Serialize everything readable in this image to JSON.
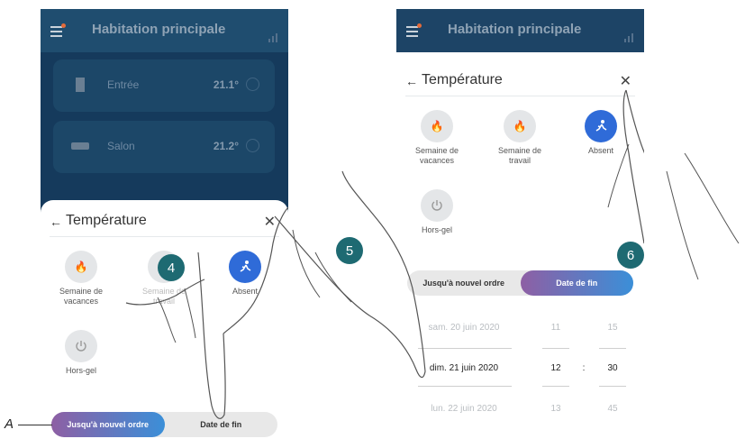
{
  "left_screen": {
    "app_title": "Habitation principale",
    "rooms": [
      {
        "name": "Entrée",
        "temp": "21.1°"
      },
      {
        "name": "Salon",
        "temp": "21.2°"
      }
    ],
    "sheet": {
      "title": "Température",
      "modes": [
        {
          "label": "Semaine de vacances",
          "icon": "flame-icon"
        },
        {
          "label": "Semaine de travail",
          "icon": "flame-icon"
        },
        {
          "label": "Absent",
          "icon": "walking-person-icon"
        },
        {
          "label": "Hors-gel",
          "icon": "power-icon"
        }
      ],
      "segment": {
        "option_1": "Jusqu'à nouvel ordre",
        "option_2": "Date de fin",
        "selected": "option_1"
      }
    }
  },
  "right_screen": {
    "app_title": "Habitation principale",
    "sheet": {
      "title": "Température",
      "modes": [
        {
          "label": "Semaine de vacances",
          "icon": "flame-icon"
        },
        {
          "label": "Semaine de travail",
          "icon": "flame-icon"
        },
        {
          "label": "Absent",
          "icon": "walking-person-icon"
        },
        {
          "label": "Hors-gel",
          "icon": "power-icon"
        }
      ],
      "segment": {
        "option_1": "Jusqu'à nouvel ordre",
        "option_2": "Date de fin",
        "selected": "option_2"
      },
      "picker": [
        {
          "date": "sam. 20 juin 2020",
          "hour": "11",
          "minute": "15"
        },
        {
          "date": "dim. 21 juin 2020",
          "hour": "12",
          "minute": "30"
        },
        {
          "date": "lun. 22 juin 2020",
          "hour": "13",
          "minute": "45"
        }
      ],
      "separator": ":"
    }
  },
  "steps": {
    "step4": "4",
    "step5": "5",
    "step6": "6"
  },
  "callout_label": "A",
  "colors": {
    "header": "#1d4466",
    "accent": "#2f6bd8",
    "badge": "#1e6a72",
    "gradient_start": "#8e5fa4",
    "gradient_end": "#3b8fd8"
  }
}
